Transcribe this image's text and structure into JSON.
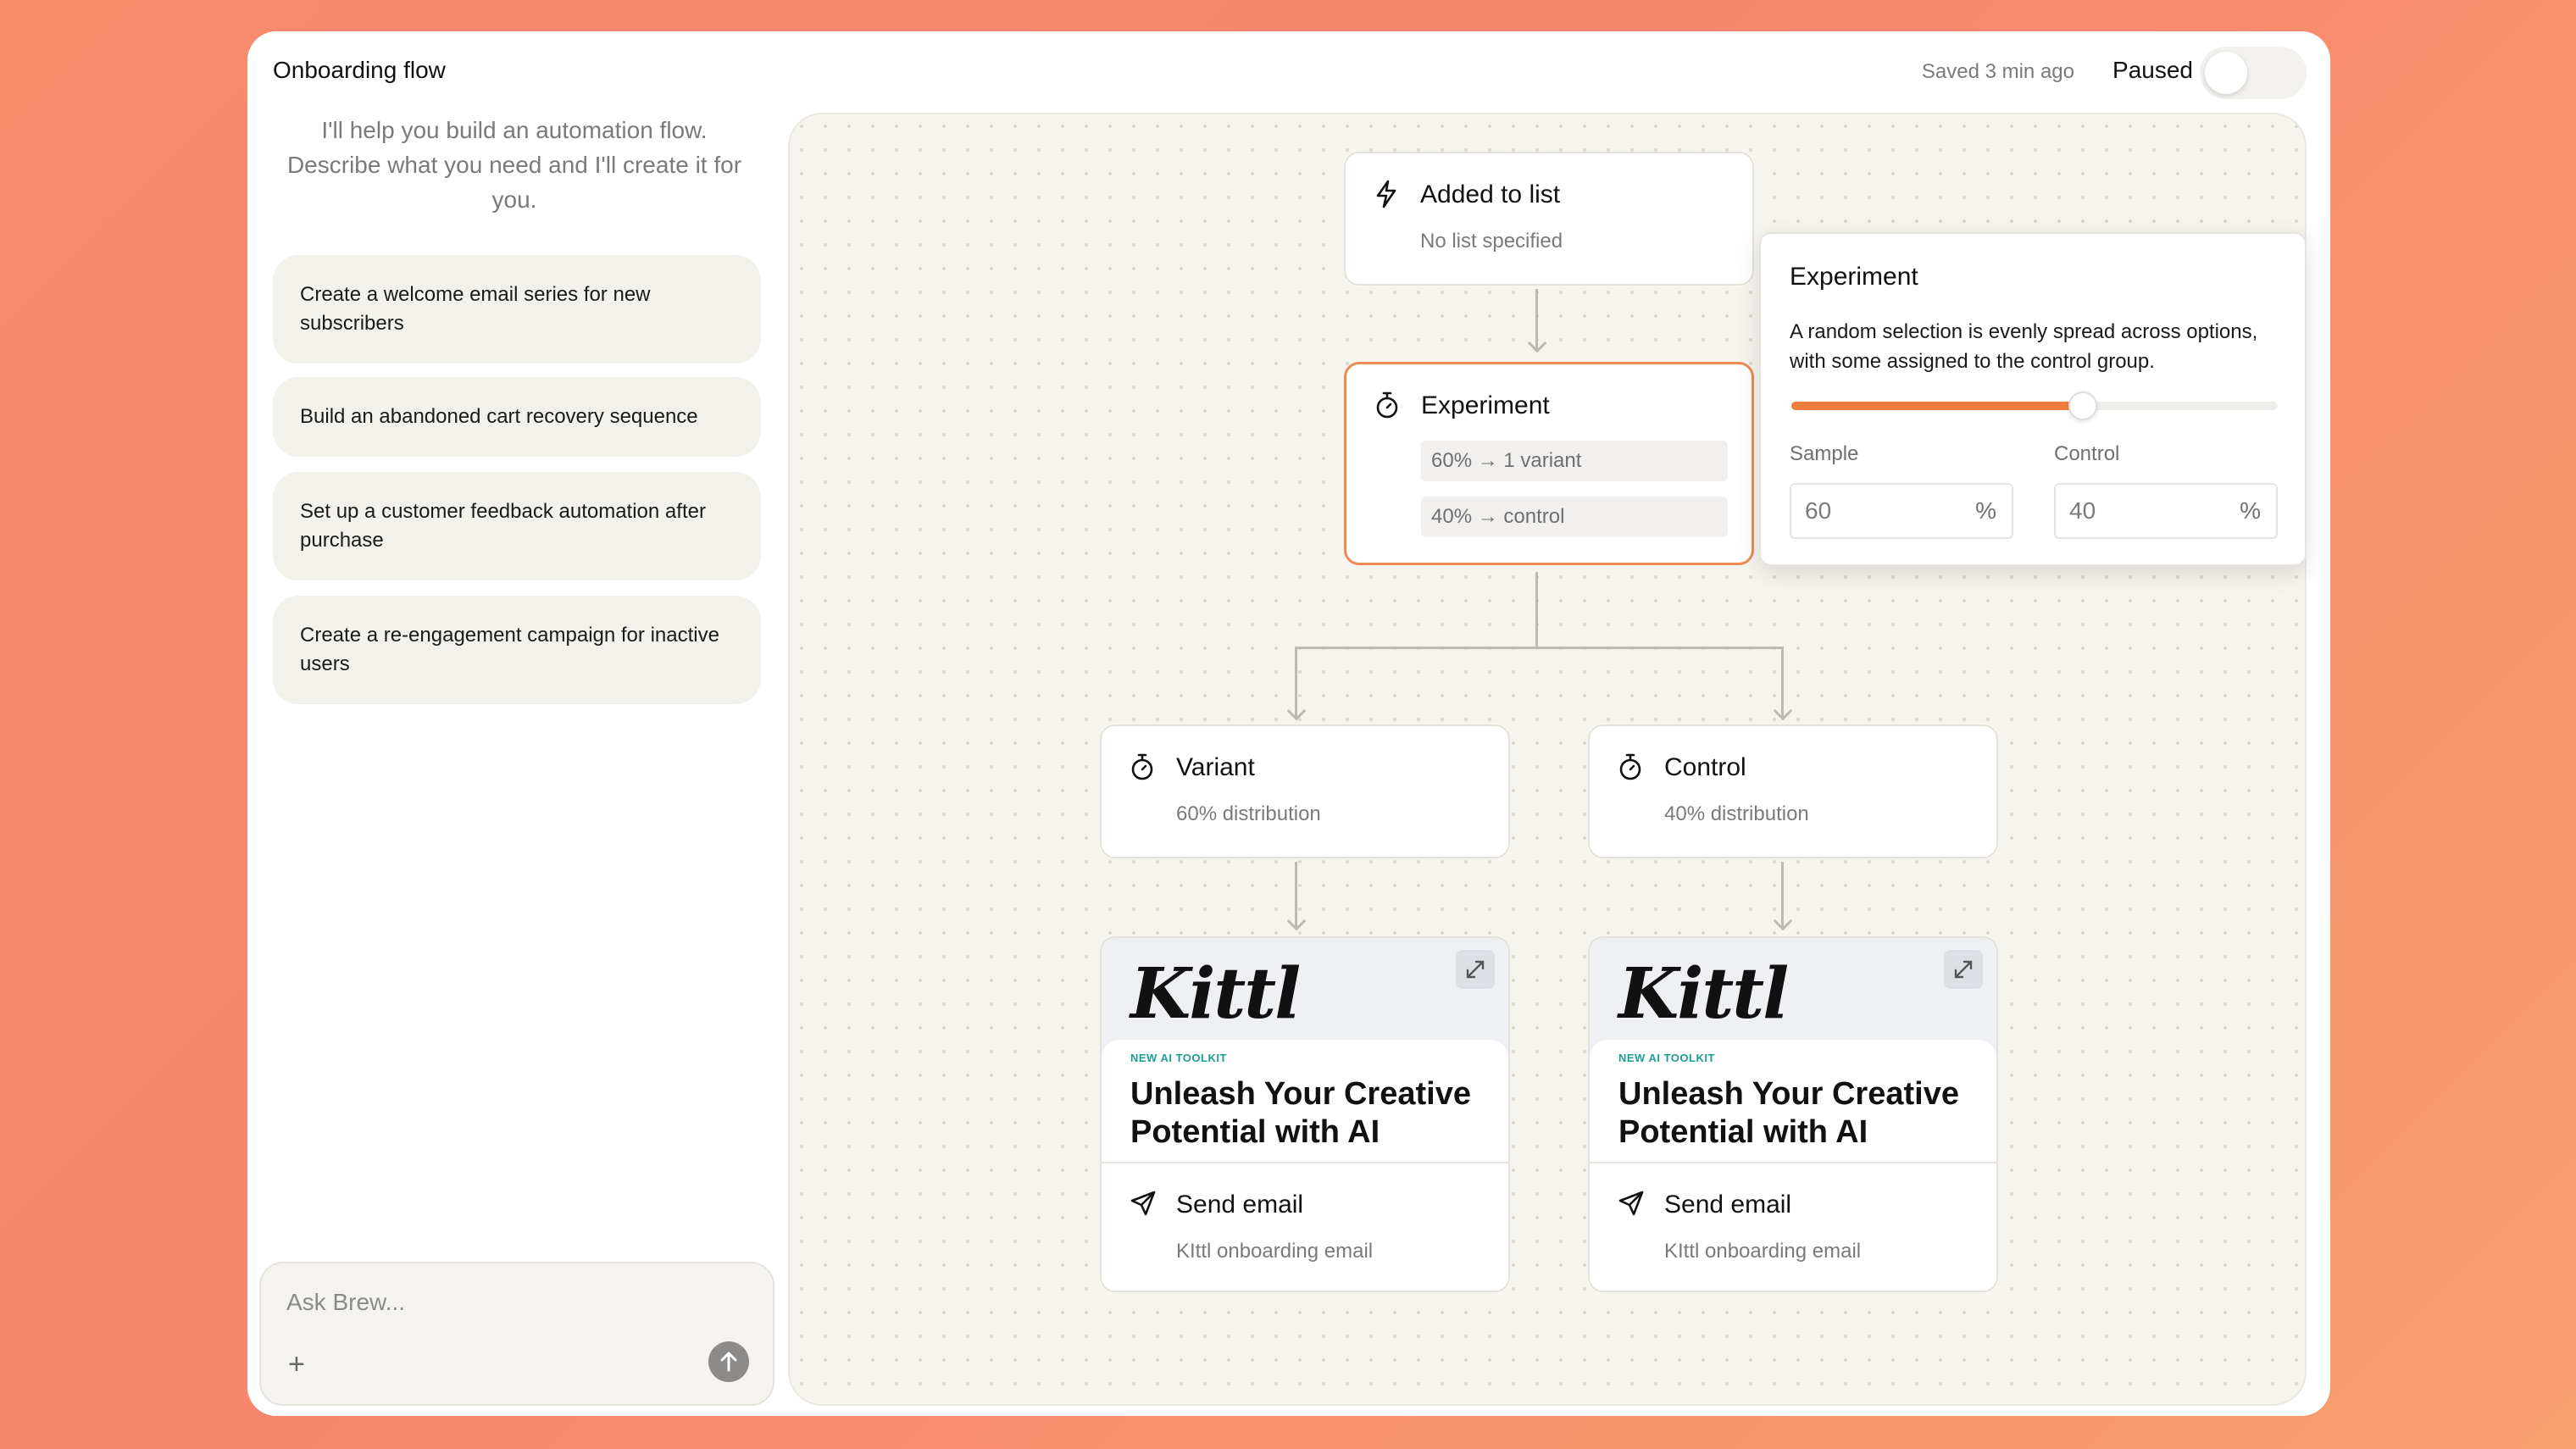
{
  "header": {
    "title": "Onboarding flow",
    "saved_status": "Saved 3 min ago",
    "state_label": "Paused"
  },
  "assistant": {
    "intro": "I'll help you build an automation flow. Describe what you need and I'll create it for you.",
    "suggestions": [
      "Create a welcome email series for new subscribers",
      "Build an abandoned cart recovery sequence",
      "Set up a customer feedback automation after purchase",
      "Create a re-engagement campaign for inactive users"
    ],
    "composer_placeholder": "Ask Brew...",
    "add_label": "+"
  },
  "flow": {
    "trigger": {
      "title": "Added to list",
      "subtitle": "No list specified",
      "icon": "lightning-icon"
    },
    "experiment": {
      "title": "Experiment",
      "icon": "stopwatch-icon",
      "rule_variant": "60% → 1 variant",
      "rule_control": "40% → control"
    },
    "variant": {
      "title": "Variant",
      "subtitle": "60% distribution",
      "icon": "stopwatch-icon"
    },
    "control": {
      "title": "Control",
      "subtitle": "40% distribution",
      "icon": "stopwatch-icon"
    },
    "email_left": {
      "brand": "Kittl",
      "eyebrow": "NEW AI TOOLKIT",
      "headline": "Unleash Your Creative Potential with AI",
      "title": "Send email",
      "subtitle": "KIttl onboarding email",
      "icon": "send-icon"
    },
    "email_right": {
      "brand": "Kittl",
      "eyebrow": "NEW AI TOOLKIT",
      "headline": "Unleash Your Creative Potential with AI",
      "title": "Send email",
      "subtitle": "KIttl onboarding email",
      "icon": "send-icon"
    }
  },
  "popover": {
    "title": "Experiment",
    "description": "A random selection is evenly spread across options, with some assigned to the control group.",
    "split_fraction": 0.6,
    "sample_label": "Sample",
    "sample_value": "60",
    "control_label": "Control",
    "control_value": "40",
    "unit": "%"
  },
  "colors": {
    "accent": "#f07c3e",
    "selected_border": "#f08a52",
    "eyebrow": "#1aa08f"
  }
}
